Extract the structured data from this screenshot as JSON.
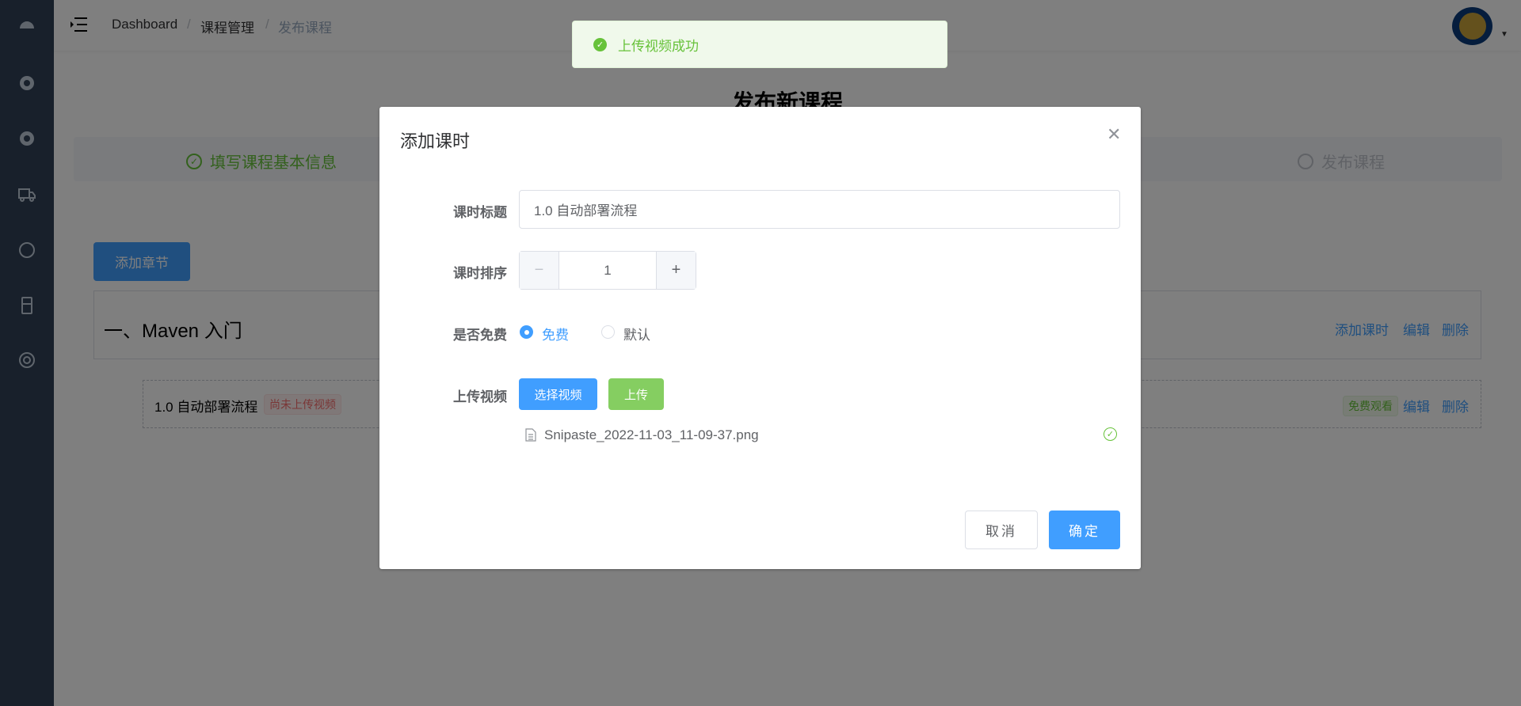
{
  "breadcrumb": [
    "Dashboard",
    "课程管理",
    "发布课程"
  ],
  "page_title": "发布新课程",
  "steps": [
    {
      "label": "填写课程基本信息",
      "status": "done"
    },
    {
      "label": "发布课程",
      "status": "wait"
    }
  ],
  "add_chapter_label": "添加章节",
  "chapter": {
    "title": "一、Maven 入门",
    "actions": [
      "添加课时",
      "编辑",
      "删除"
    ]
  },
  "lesson": {
    "title": "1.0 自动部署流程",
    "status_tag": "尚未上传视频",
    "free_tag": "免费观看",
    "actions": [
      "编辑",
      "删除"
    ]
  },
  "dialog": {
    "title": "添加课时",
    "fields": {
      "title_label": "课时标题",
      "title_value": "1.0 自动部署流程",
      "sort_label": "课时排序",
      "sort_value": "1",
      "free_label": "是否免费",
      "free_options": [
        "免费",
        "默认"
      ],
      "free_selected": "免费",
      "upload_label": "上传视频",
      "select_video": "选择视频",
      "upload": "上传",
      "file_name": "Snipaste_2022-11-03_11-09-37.png"
    },
    "cancel": "取消",
    "confirm": "确定"
  },
  "toast": {
    "message": "上传视频成功",
    "type": "success"
  },
  "colors": {
    "primary": "#409eff",
    "success": "#67c23a",
    "sidebar": "#304156",
    "danger": "#f56c6c"
  }
}
